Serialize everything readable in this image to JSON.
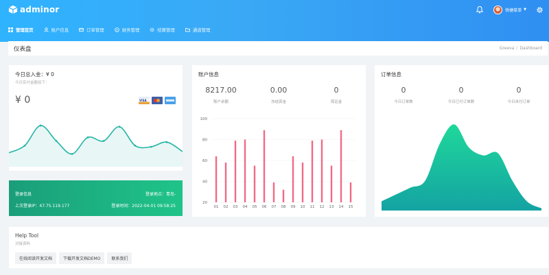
{
  "header": {
    "logo_text": "adminor",
    "username": "快捷菜单",
    "nav": [
      {
        "label": "管理首页",
        "icon": "grid-icon",
        "active": true
      },
      {
        "label": "账户信息",
        "icon": "user-icon",
        "active": false
      },
      {
        "label": "订单管理",
        "icon": "card-icon",
        "active": false
      },
      {
        "label": "财务管理",
        "icon": "coin-icon",
        "active": false
      },
      {
        "label": "结算管理",
        "icon": "gear-icon",
        "active": false
      },
      {
        "label": "通道管理",
        "icon": "folder-icon",
        "active": false
      }
    ]
  },
  "breadcrumb": {
    "title": "仪表盘",
    "home": "Greeva",
    "current": "Dashboard"
  },
  "today": {
    "title": "今日总入金：¥ 0",
    "subtitle": "今日实付金额如下：",
    "amount": "¥ 0",
    "payment_icons": [
      "visa-card-icon",
      "mastercard-icon",
      "amex-card-icon"
    ],
    "trend": [
      20,
      32,
      66,
      40,
      18,
      46,
      40,
      64,
      32,
      30,
      38,
      22
    ]
  },
  "login": {
    "info_label": "登录信息",
    "location": "登录地点：青岛-",
    "ip": "上次登录IP：47.75.119.177",
    "time": "登录时间：2022-04-01 09:58:25"
  },
  "account": {
    "title": "账户信息",
    "stats": [
      {
        "value": "8217.00",
        "label": "账户余额"
      },
      {
        "value": "0.00",
        "label": "冻结资金"
      },
      {
        "value": "0",
        "label": "保证金"
      }
    ]
  },
  "orders": {
    "title": "订单信息",
    "stats": [
      {
        "value": "0",
        "label": "今日订单数"
      },
      {
        "value": "0",
        "label": "今日已付订单数"
      },
      {
        "value": "0",
        "label": "今日未付订单"
      }
    ],
    "area": [
      8,
      14,
      20,
      26,
      58,
      75,
      55,
      48,
      50,
      26,
      8,
      2
    ]
  },
  "chart_data": {
    "type": "bar",
    "categories": [
      "01",
      "02",
      "03",
      "04",
      "05",
      "06",
      "07",
      "08",
      "09",
      "10",
      "11",
      "12",
      "13",
      "14",
      "15"
    ],
    "values": [
      64,
      58,
      79,
      80,
      55,
      89,
      39,
      32,
      64,
      58,
      79,
      80,
      55,
      89,
      39
    ],
    "ylim": [
      20,
      100
    ],
    "yticks": [
      20,
      40,
      60,
      80,
      100
    ],
    "color": "#f06a86"
  },
  "help": {
    "title": "Help Tool",
    "subtitle": "对接资料",
    "buttons": [
      "在线阅读开发文档",
      "下载开发文档DEMO",
      "联系我们"
    ]
  },
  "colors": {
    "accent": "#2f9bf3",
    "teal": "#22b5a5",
    "green": "#1fc489",
    "bar": "#f06a86"
  }
}
